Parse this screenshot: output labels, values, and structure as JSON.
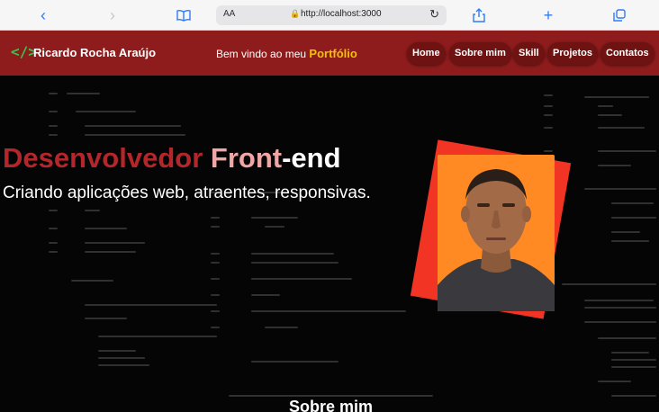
{
  "browser": {
    "address_prefix": "AA",
    "url": "http://localhost:3000"
  },
  "header": {
    "brand": "Ricardo Rocha Araújo",
    "welcome_text": "Bem vindo ao meu",
    "welcome_highlight": "Portfólio",
    "nav": [
      {
        "label": "Home"
      },
      {
        "label": "Sobre mim"
      },
      {
        "label": "Skill"
      },
      {
        "label": "Projetos"
      },
      {
        "label": "Contatos"
      }
    ]
  },
  "hero": {
    "title_part1": "Desenvolvedor",
    "title_part2": " Front",
    "title_part3": "-end",
    "subtitle": "Criando aplicações web, atraentes, responsivas."
  },
  "next_section": {
    "title": "Sobre mim"
  },
  "colors": {
    "navbar": "#8f1c1c",
    "nav_button": "#6f1212",
    "highlight": "#f2c200",
    "logo": "#3cc14f",
    "photo_background": "#ff8a23",
    "photo_frame": "#f13423"
  }
}
